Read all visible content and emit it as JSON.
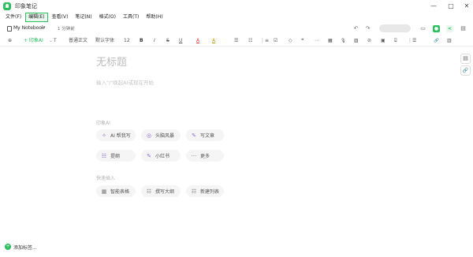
{
  "window": {
    "title": "印象笔记",
    "minimize": "—",
    "maximize": "□",
    "close": "✕"
  },
  "menu": [
    "文件(F)",
    "编辑(E)",
    "查看(V)",
    "笔记(N)",
    "格式(O)",
    "工具(T)",
    "帮助(H)"
  ],
  "menu_active_index": 1,
  "notebook": {
    "name": "My Notebook",
    "caret": "▾",
    "time": "1 分钟前"
  },
  "topbar_icons": {
    "undo": "↶",
    "redo": "↷",
    "present": "▭",
    "user": "●",
    "share": "<",
    "more": "▤"
  },
  "format_toolbar": {
    "add": "⊕",
    "ai": "+ 印象AI",
    "heading": " T",
    "style": "普通正文",
    "font": "默认字体",
    "size": "12",
    "bold": "B",
    "italic": "I",
    "strike": "S",
    "underline": "U",
    "font_color": "A",
    "highlight": "A",
    "align": "☰",
    "bullet_list": "☷",
    "numbered_list": "⋮≡",
    "check_list": "☑",
    "clear": "◇",
    "quote": "❝",
    "divider": "⋯",
    "table": "▦",
    "audio": "🎙",
    "image": "▨",
    "attach": "⊘",
    "calendar": "▣",
    "code": "⌸",
    "outline": "⋮☰",
    "link": "🔗",
    "doc": "▥"
  },
  "editor": {
    "title_placeholder": "无标题",
    "body_placeholder": "输入\"/\"唤起AI或现在开始"
  },
  "ai_section": {
    "label": "印象AI",
    "chips": [
      {
        "icon": "✧",
        "label": "AI 帮我写"
      },
      {
        "icon": "◎",
        "label": "头脑风暴"
      },
      {
        "icon": "✎",
        "label": "写文章"
      },
      {
        "icon": "☷",
        "label": "提纲"
      },
      {
        "icon": "✎",
        "label": "小红书"
      },
      {
        "icon": "···",
        "label": "更多"
      }
    ]
  },
  "insert_section": {
    "label": "快速插入",
    "chips": [
      {
        "icon": "▦",
        "label": "智能表格"
      },
      {
        "icon": "☷",
        "label": "撰写大纲"
      },
      {
        "icon": "☷",
        "label": "新建列表"
      }
    ]
  },
  "right_rail": {
    "btn1": "▤",
    "btn2": "🔗"
  },
  "footer": {
    "icon": "+",
    "label": "添加标签..."
  },
  "colors": {
    "accent": "#2dbe60",
    "ai_purple": "#8b6bd9"
  }
}
